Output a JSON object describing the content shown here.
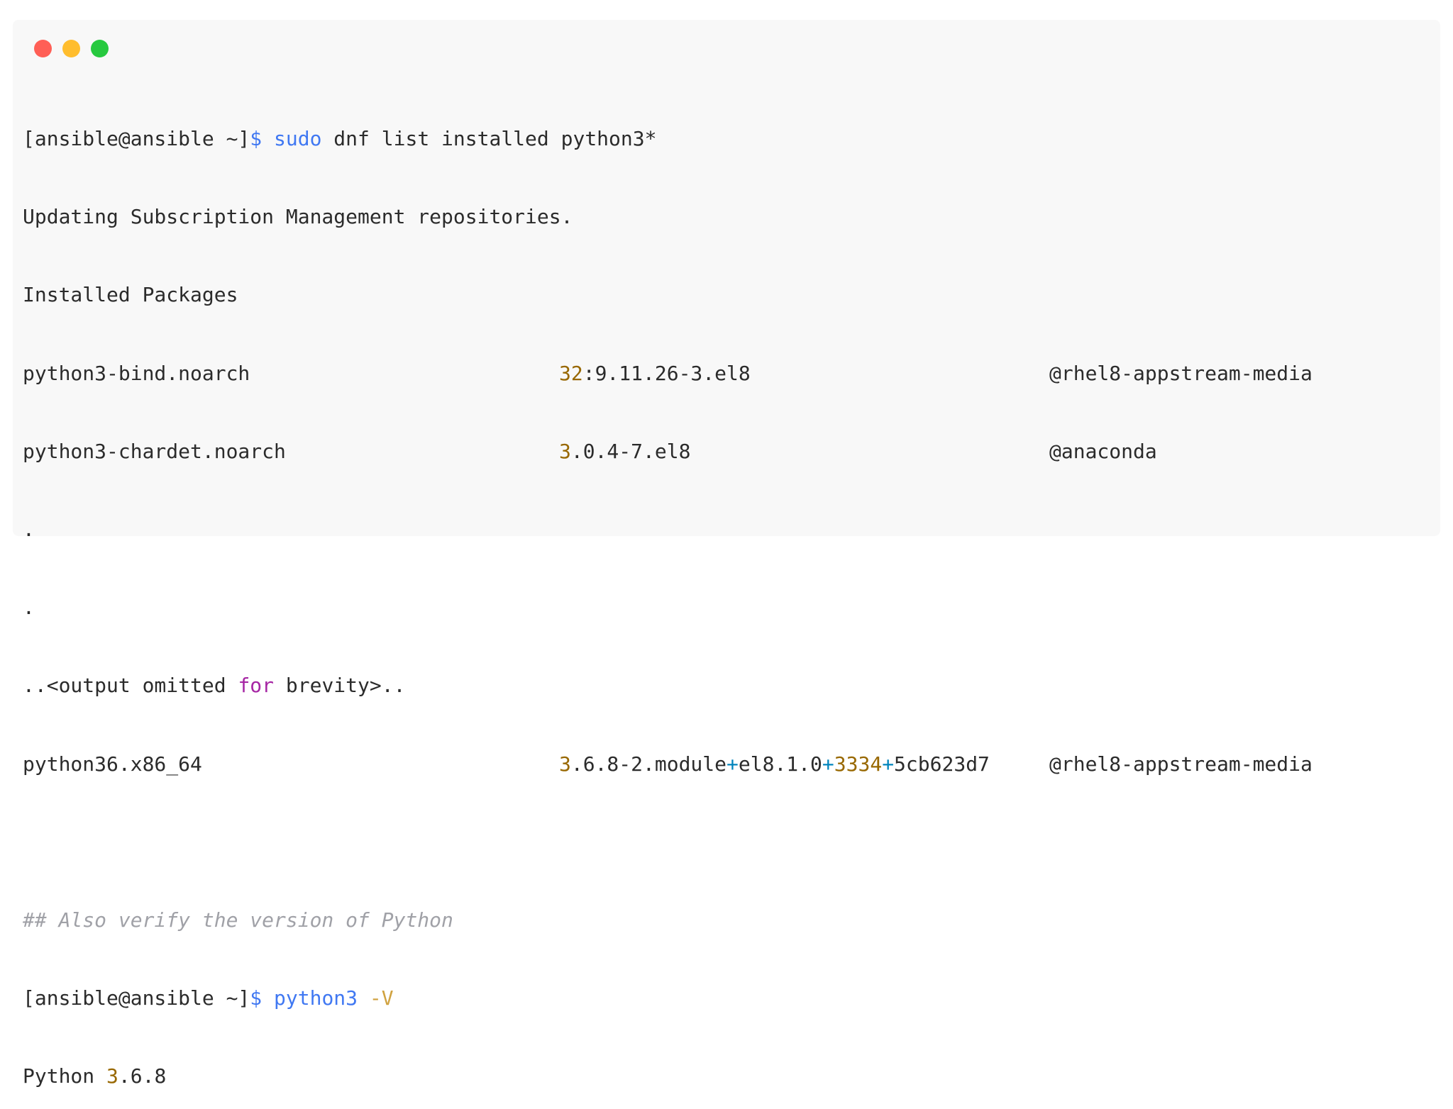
{
  "window": {
    "controls": [
      "close",
      "minimize",
      "maximize"
    ]
  },
  "terminal": {
    "line1": {
      "prompt": "[ansible@ansible ~]",
      "dollar": "$",
      "sudo": "sudo",
      "rest": " dnf list installed python3*"
    },
    "line2": "Updating Subscription Management repositories.",
    "line3": "Installed Packages",
    "pkg1": {
      "name": "python3-bind.noarch",
      "ver_num": "32",
      "ver_rest": ":9.11.26-3.el8",
      "repo": "@rhel8-appstream-media"
    },
    "pkg2": {
      "name": "python3-chardet.noarch",
      "ver_num": "3",
      "ver_rest": ".0.4-7.el8",
      "repo": "@anaconda"
    },
    "dot1": ".",
    "dot2": ".",
    "omit": {
      "pre": "..<output omitted ",
      "kw": "for",
      "post": " brevity>.."
    },
    "pkg3": {
      "name": "python36.x86_64",
      "v1": "3",
      "v2": ".6.8-2.module",
      "plus1": "+",
      "v3": "el8.1.0",
      "plus2": "+",
      "v4": "3334",
      "plus3": "+",
      "v5": "5cb623d7",
      "repo": "@rhel8-appstream-media"
    },
    "comment": "## Also verify the version of Python",
    "line_v": {
      "prompt": "[ansible@ansible ~]",
      "dollar": "$",
      "cmd": "python3",
      "flag": "-V"
    },
    "out": {
      "pre": "Python ",
      "num": "3",
      "post": ".6.8"
    }
  },
  "colors": {
    "keyword": "#4078f2",
    "number": "#986801",
    "operator": "#0184bc",
    "comment": "#a0a1a7",
    "control_kw": "#a626a4"
  }
}
